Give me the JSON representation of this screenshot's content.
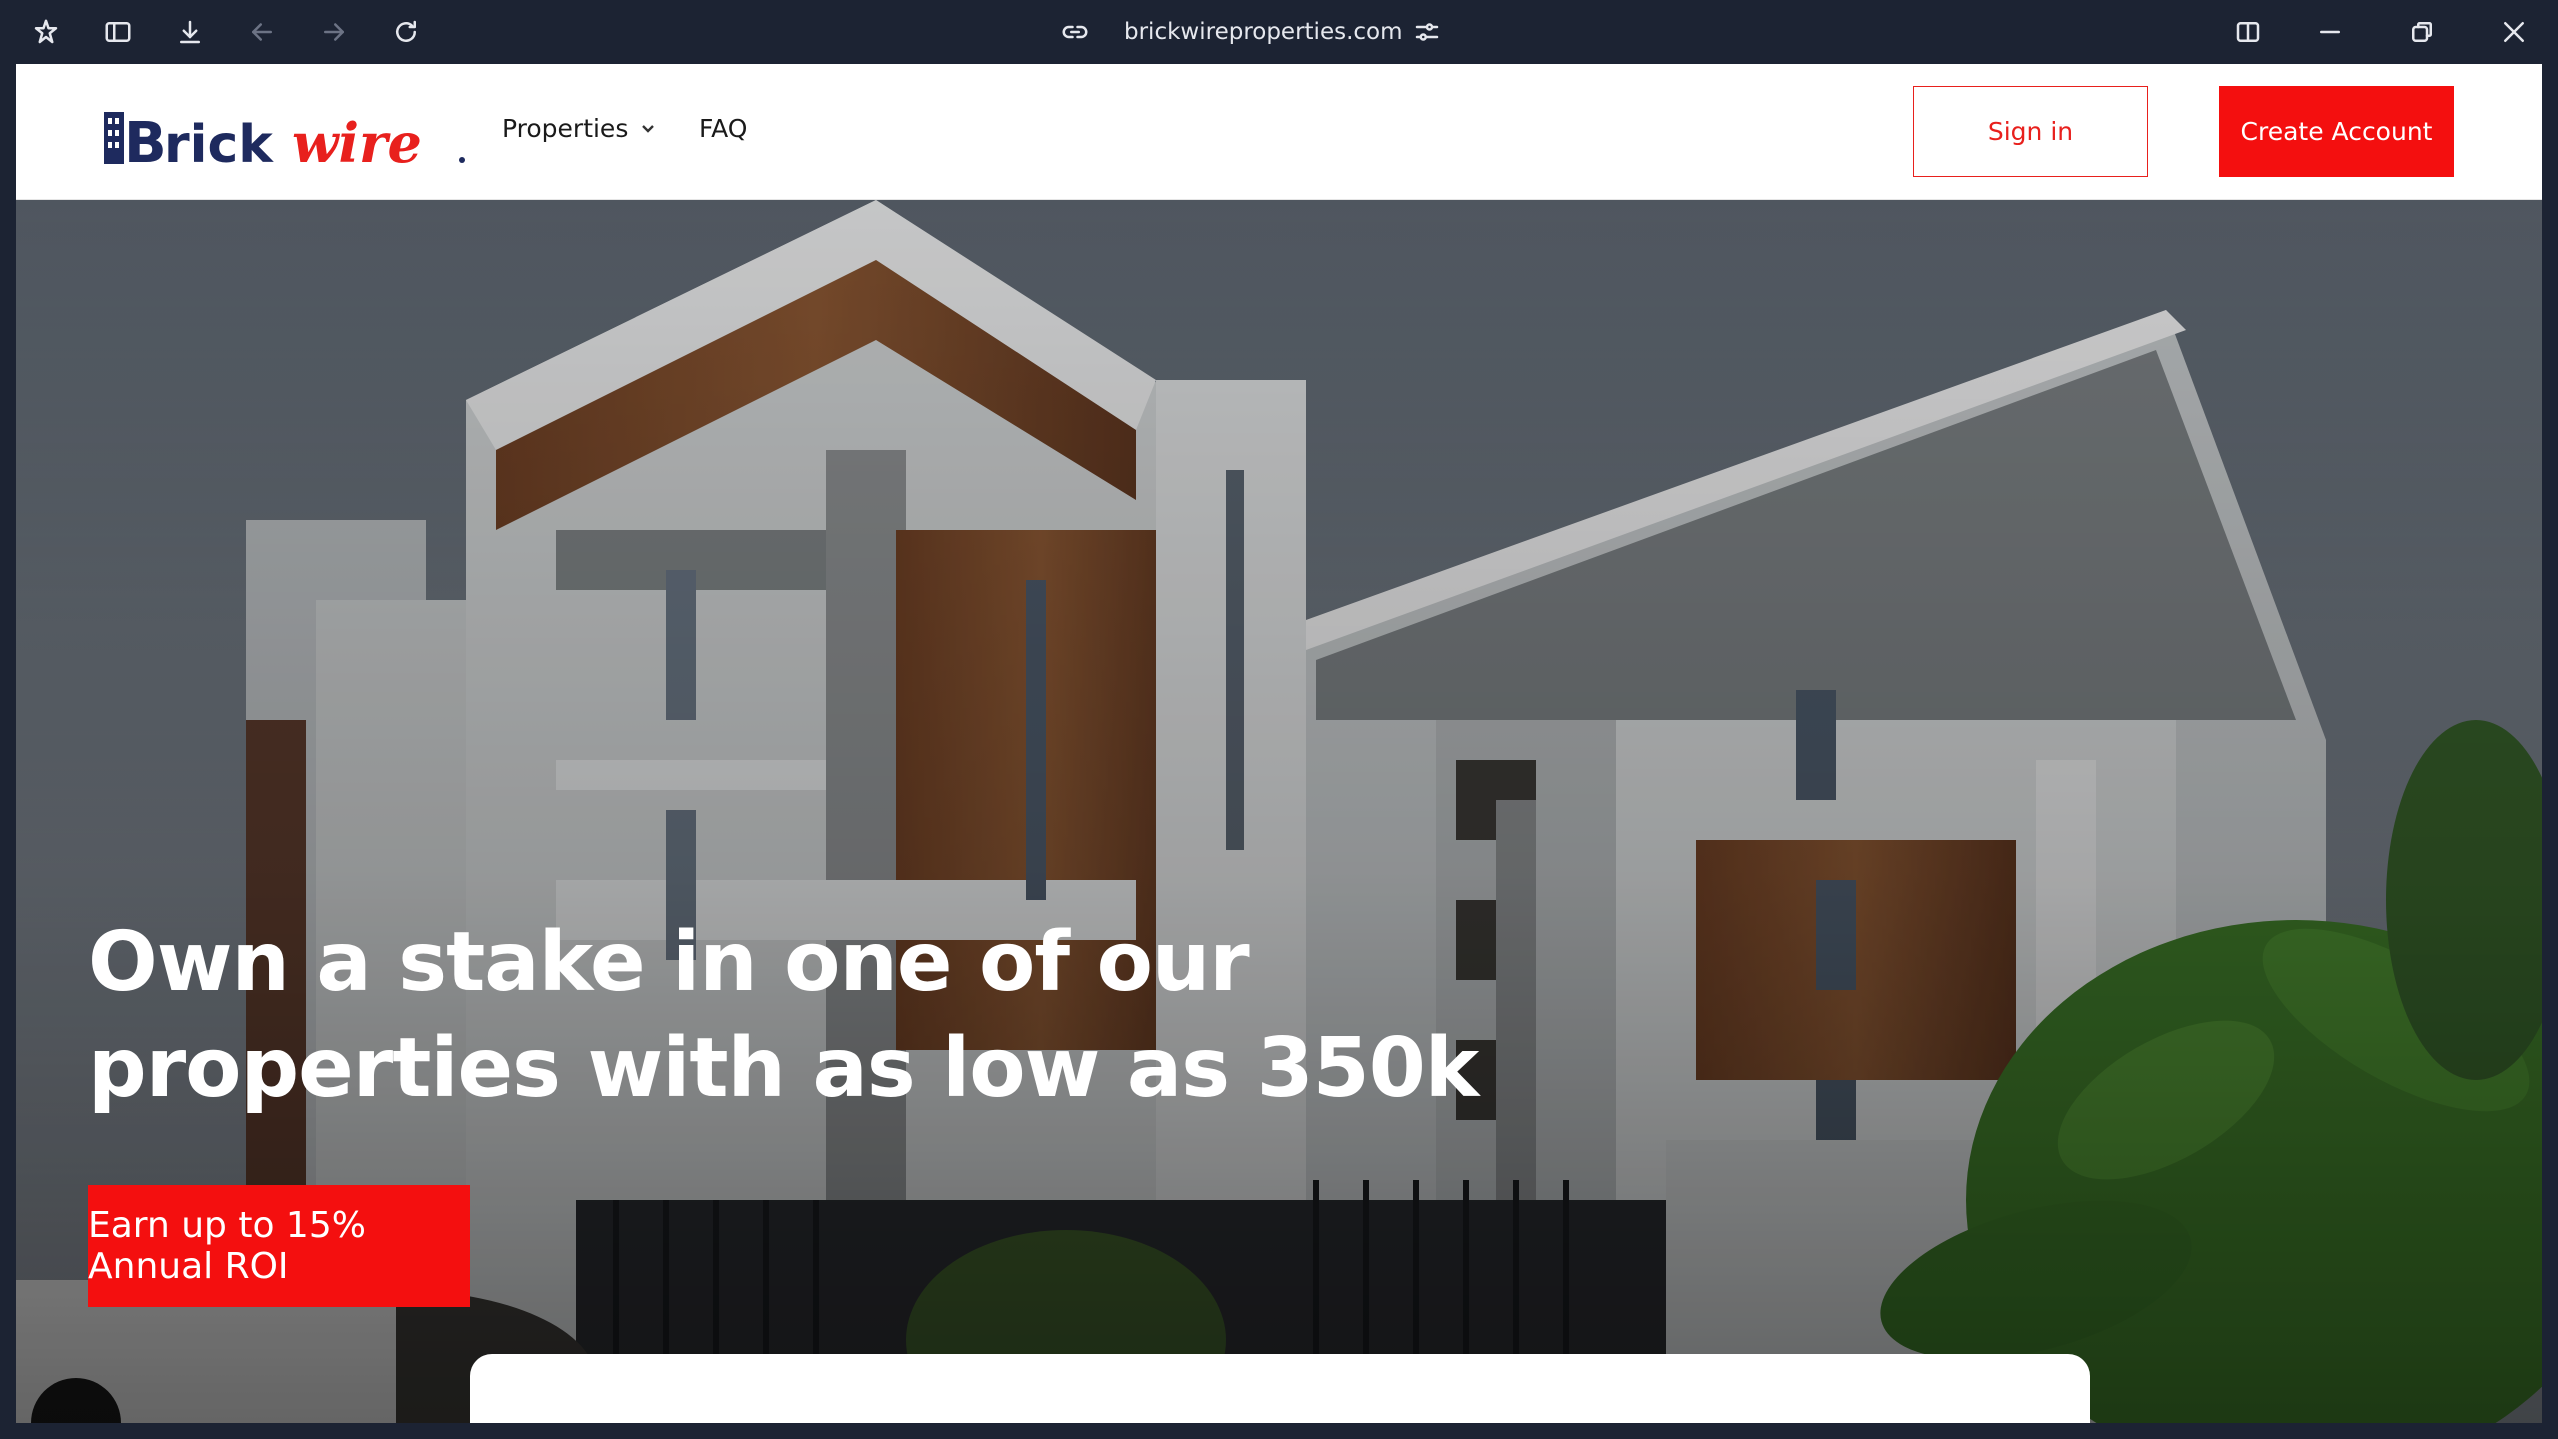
{
  "browser": {
    "url": "brickwireproperties.com",
    "icons": [
      "app-logo-icon",
      "sidebar-toggle-icon",
      "download-icon",
      "back-arrow-icon",
      "forward-arrow-icon",
      "reload-icon",
      "link-icon",
      "site-settings-icon",
      "split-view-icon",
      "minimize-icon",
      "restore-icon",
      "close-icon"
    ]
  },
  "header": {
    "logo_text": "Brickwire",
    "nav": [
      {
        "label": "Properties",
        "has_dropdown": true
      },
      {
        "label": "FAQ",
        "has_dropdown": false
      }
    ],
    "sign_in_label": "Sign in",
    "create_account_label": "Create Account"
  },
  "hero": {
    "title": "Own a stake in one of our properties with as low as 350k",
    "cta_label": "Earn up to 15% Annual ROI"
  },
  "colors": {
    "brand_red": "#f40f0f",
    "brand_navy": "#1e2a5e",
    "chrome_bg": "#1c2333"
  }
}
